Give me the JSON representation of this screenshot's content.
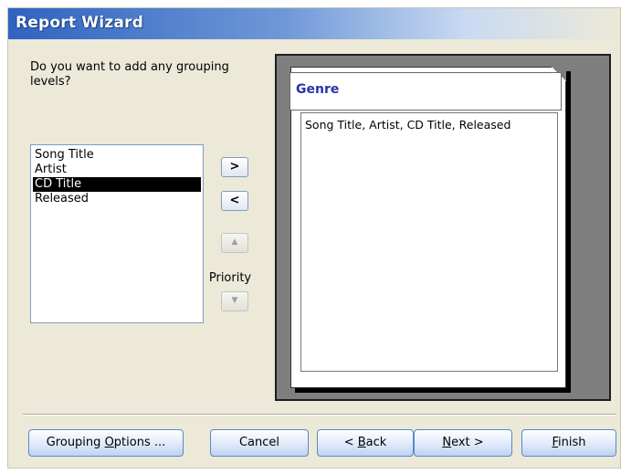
{
  "window": {
    "title": "Report Wizard"
  },
  "prompt": "Do you want to add any grouping levels?",
  "fields": [
    {
      "label": "Song Title",
      "selected": false
    },
    {
      "label": "Artist",
      "selected": false
    },
    {
      "label": "CD Title",
      "selected": true
    },
    {
      "label": "Released",
      "selected": false
    }
  ],
  "controls": {
    "add_label": ">",
    "remove_label": "<",
    "up_label": "▲",
    "down_label": "▼",
    "priority_label": "Priority"
  },
  "preview": {
    "group_header": "Genre",
    "detail_fields": "Song Title, Artist, CD Title, Released"
  },
  "buttons": {
    "grouping_options": {
      "pre": "Grouping ",
      "key": "O",
      "post": "ptions ..."
    },
    "cancel": {
      "pre": "Cancel",
      "key": "",
      "post": ""
    },
    "back": {
      "pre": "< ",
      "key": "B",
      "post": "ack"
    },
    "next": {
      "pre": "",
      "key": "N",
      "post": "ext >"
    },
    "finish": {
      "pre": "",
      "key": "F",
      "post": "inish"
    }
  }
}
